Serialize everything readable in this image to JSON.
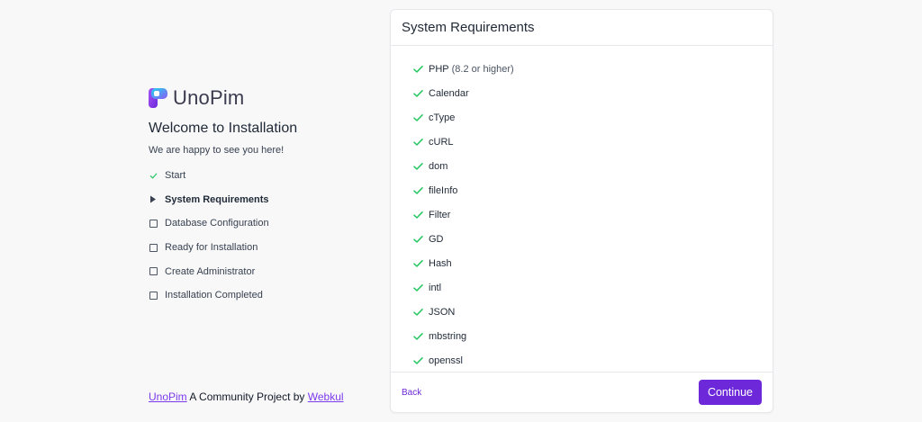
{
  "brand": {
    "name": "UnoPim",
    "accent": "#6d28d9",
    "check_color": "#22c55e"
  },
  "welcome": {
    "title": "Welcome to Installation",
    "subtitle": "We are happy to see you here!"
  },
  "steps": [
    {
      "label": "Start",
      "status": "done",
      "icon": "check-icon"
    },
    {
      "label": "System Requirements",
      "status": "active",
      "icon": "triangle-right-icon"
    },
    {
      "label": "Database Configuration",
      "status": "pending",
      "icon": "checkbox-icon"
    },
    {
      "label": "Ready for Installation",
      "status": "pending",
      "icon": "checkbox-icon"
    },
    {
      "label": "Create Administrator",
      "status": "pending",
      "icon": "checkbox-icon"
    },
    {
      "label": "Installation Completed",
      "status": "pending",
      "icon": "checkbox-icon"
    }
  ],
  "footer": {
    "project_link": "UnoPim",
    "middle_text": " A Community Project by ",
    "company_link": "Webkul"
  },
  "card": {
    "title": "System Requirements",
    "requirements": [
      {
        "name": "PHP",
        "note": "(8.2 or higher)"
      },
      {
        "name": "Calendar",
        "note": ""
      },
      {
        "name": "cType",
        "note": ""
      },
      {
        "name": "cURL",
        "note": ""
      },
      {
        "name": "dom",
        "note": ""
      },
      {
        "name": "fileInfo",
        "note": ""
      },
      {
        "name": "Filter",
        "note": ""
      },
      {
        "name": "GD",
        "note": ""
      },
      {
        "name": "Hash",
        "note": ""
      },
      {
        "name": "intl",
        "note": ""
      },
      {
        "name": "JSON",
        "note": ""
      },
      {
        "name": "mbstring",
        "note": ""
      },
      {
        "name": "openssl",
        "note": ""
      }
    ],
    "back_label": "Back",
    "continue_label": "Continue"
  }
}
